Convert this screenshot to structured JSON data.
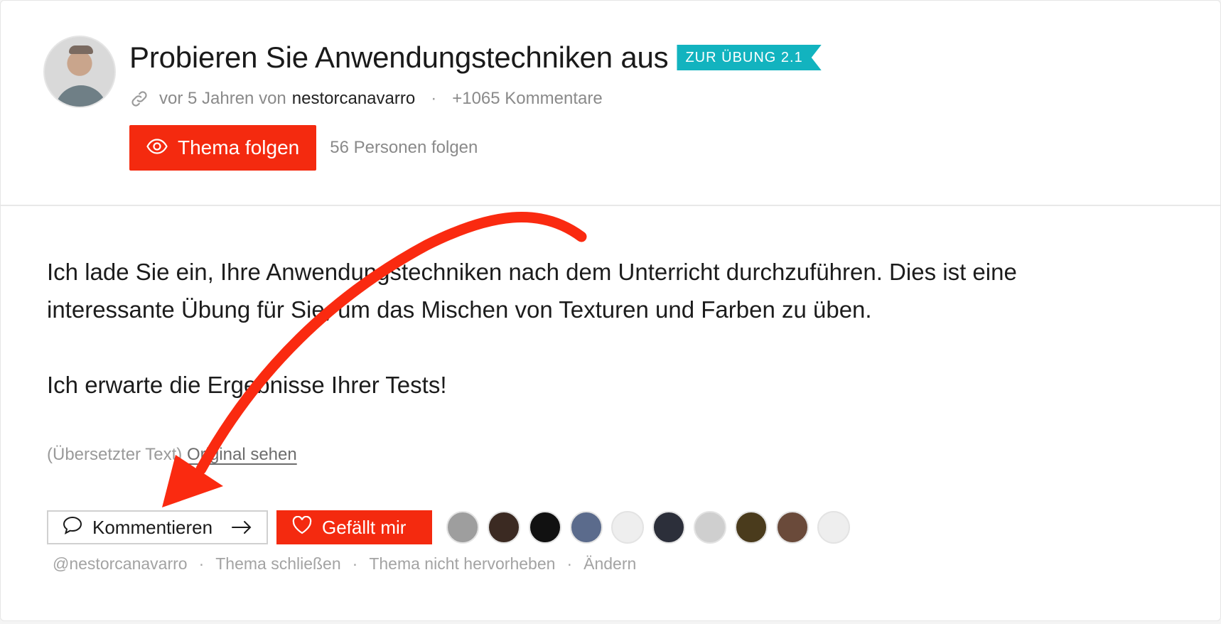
{
  "topic": {
    "title": "Probieren Sie Anwendungstechniken aus",
    "badge": "ZUR ÜBUNG 2.1",
    "time_ago": "vor 5 Jahren von",
    "author": "nestorcanavarro",
    "separator": "·",
    "comments": "+1065 Kommentare"
  },
  "follow": {
    "button_label": "Thema folgen",
    "count_text": "56 Personen folgen"
  },
  "body": {
    "paragraph1_line1": "Ich lade Sie ein, Ihre Anwendungstechniken nach dem Unterricht durchzuführen. Dies ist eine",
    "paragraph1_line2": "interessante Übung für Sie, um das Mischen von Texturen und Farben zu üben.",
    "paragraph2": "Ich erwarte die Ergebnisse Ihrer Tests!"
  },
  "translation": {
    "note": "(Übersetzter Text)",
    "original_link": "Original sehen"
  },
  "actions": {
    "comment_label": "Kommentieren",
    "like_label": "Gefällt mir"
  },
  "likers": [
    {
      "color": "#9e9e9e"
    },
    {
      "color": "#3b2a22"
    },
    {
      "color": "#111111"
    },
    {
      "color": "#5b6b8c"
    },
    {
      "color": "#eeeeee"
    },
    {
      "color": "#2c2f3a"
    },
    {
      "color": "#cfcfcf"
    },
    {
      "color": "#4a3b1c"
    },
    {
      "color": "#6a4a3a"
    },
    {
      "color": "#eeeeee"
    }
  ],
  "footer": {
    "mention": "@nestorcanavarro",
    "close_topic": "Thema schließen",
    "unfeature": "Thema nicht hervorheben",
    "edit": "Ändern",
    "separator": "·"
  },
  "colors": {
    "accent_red": "#f42a0f",
    "badge_teal": "#12b3bf",
    "annotation_arrow": "#fa2a10"
  },
  "icons": {
    "meta": "link-icon",
    "follow": "eye-icon",
    "comment": "speech-bubble-icon",
    "comment_arrow": "arrow-right-icon",
    "like": "heart-icon"
  }
}
